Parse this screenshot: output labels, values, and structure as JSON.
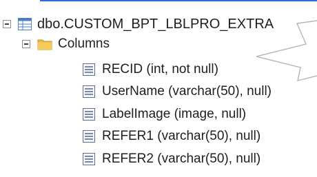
{
  "tree": {
    "table": {
      "label": "dbo.CUSTOM_BPT_LBLPRO_EXTRA",
      "icon": "table-icon",
      "expanded": true
    },
    "columns_folder": {
      "label": "Columns",
      "icon": "folder-icon",
      "expanded": true
    },
    "columns": [
      {
        "label": "RECID (int, not null)",
        "icon": "column-icon"
      },
      {
        "label": "UserName (varchar(50), null)",
        "icon": "column-icon"
      },
      {
        "label": "LabelImage (image, null)",
        "icon": "column-icon"
      },
      {
        "label": "REFER1 (varchar(50), null)",
        "icon": "column-icon"
      },
      {
        "label": "REFER2 (varchar(50), null)",
        "icon": "column-icon"
      }
    ]
  },
  "colors": {
    "selection_rule": "#2a6fd6",
    "folder": "#e8b940",
    "table_icon": "#4f7fc1",
    "callout_stroke": "#b5b5b5"
  }
}
